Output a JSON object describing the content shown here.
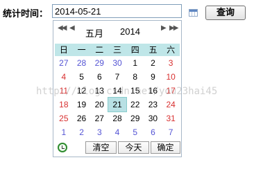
{
  "form": {
    "label": "统计时间：",
    "date_value": "2014-05-21",
    "search_label": "查询"
  },
  "calendar": {
    "nav_prev_year": "◀◀",
    "nav_prev_month": "◀",
    "month": "五月",
    "year": "2014",
    "nav_next_month": "▶",
    "nav_next_year": "▶▶",
    "weekdays": [
      "日",
      "一",
      "二",
      "三",
      "四",
      "五",
      "六"
    ],
    "weeks": [
      [
        "27",
        "28",
        "29",
        "30",
        "1",
        "2",
        "3"
      ],
      [
        "4",
        "5",
        "6",
        "7",
        "8",
        "9",
        "10"
      ],
      [
        "11",
        "12",
        "13",
        "14",
        "15",
        "16",
        "17"
      ],
      [
        "18",
        "19",
        "20",
        "21",
        "22",
        "23",
        "24"
      ],
      [
        "25",
        "26",
        "27",
        "28",
        "29",
        "30",
        "31"
      ],
      [
        "1",
        "2",
        "3",
        "4",
        "5",
        "6",
        "7"
      ]
    ],
    "selected_day": "21",
    "clear_label": "清空",
    "today_label": "今天",
    "ok_label": "确定"
  },
  "watermark": "http://blog.csdn.net/you23hai45"
}
